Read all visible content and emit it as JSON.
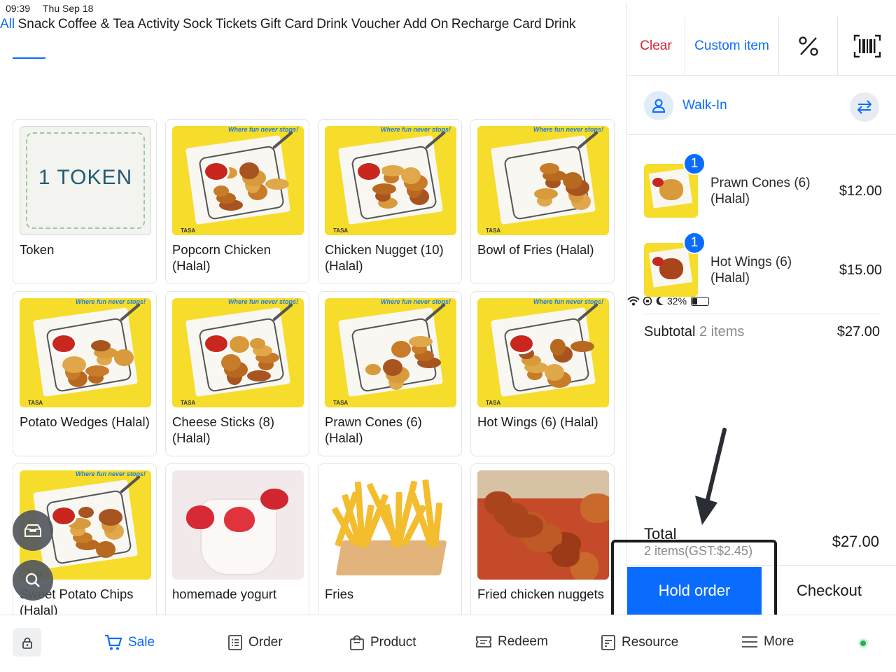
{
  "status_bar": {
    "time": "09:39",
    "date": "Thu Sep 18",
    "battery": "32%",
    "battery_level": 0.32
  },
  "categories_row1": [
    "All",
    "Snack",
    "Coffee & Tea",
    "Activity",
    "Sock",
    "Tickets",
    "Gift Card",
    "Drink Voucher"
  ],
  "categories_row2": [
    "Add On",
    "Recharge Card",
    "Drink"
  ],
  "active_category": "All",
  "products": [
    {
      "name": "Token",
      "image": "token",
      "image_text": "1 TOKEN"
    },
    {
      "name": "Popcorn Chicken (Halal)",
      "image": "snack"
    },
    {
      "name": "Chicken Nugget (10) (Halal)",
      "image": "snack"
    },
    {
      "name": "Bowl of Fries (Halal)",
      "image": "snack"
    },
    {
      "name": "Potato Wedges (Halal)",
      "image": "snack"
    },
    {
      "name": "Cheese Sticks (8) (Halal)",
      "image": "snack"
    },
    {
      "name": "Prawn Cones (6) (Halal)",
      "image": "snack"
    },
    {
      "name": "Hot Wings (6) (Halal)",
      "image": "snack"
    },
    {
      "name": "Sweet Potato Chips (Halal)",
      "image": "snack"
    },
    {
      "name": "homemade yogurt",
      "image": "yogurt"
    },
    {
      "name": "Fries",
      "image": "fries"
    },
    {
      "name": "Fried chicken nuggets",
      "image": "fried"
    }
  ],
  "product_image_tag": "Where fun never stops!",
  "product_image_brand": "TASA",
  "toolbar": {
    "clear": "Clear",
    "custom_item": "Custom item",
    "discount_icon": "percent-icon",
    "barcode_icon": "barcode-icon"
  },
  "customer": {
    "name": "Walk-In"
  },
  "cart_items": [
    {
      "qty": "1",
      "name": "Prawn Cones (6) (Halal)",
      "price": "$12.00"
    },
    {
      "qty": "1",
      "name": "Hot Wings (6) (Halal)",
      "price": "$15.00"
    }
  ],
  "subtotal": {
    "label": "Subtotal",
    "count": "2 items",
    "amount": "$27.00"
  },
  "total": {
    "label": "Total",
    "sub": "2 items(GST:$2.45)",
    "amount": "$27.00"
  },
  "actions": {
    "hold": "Hold order",
    "checkout": "Checkout"
  },
  "nav": [
    {
      "label": "Sale",
      "icon": "cart-icon",
      "active": true
    },
    {
      "label": "Order",
      "icon": "list-icon"
    },
    {
      "label": "Product",
      "icon": "bag-icon"
    },
    {
      "label": "Redeem",
      "icon": "ticket-icon"
    },
    {
      "label": "Resource",
      "icon": "document-icon"
    },
    {
      "label": "More",
      "icon": "menu-icon"
    }
  ],
  "colors": {
    "accent": "#0a6cff",
    "clear": "#e0202b",
    "online": "#1fb255"
  }
}
